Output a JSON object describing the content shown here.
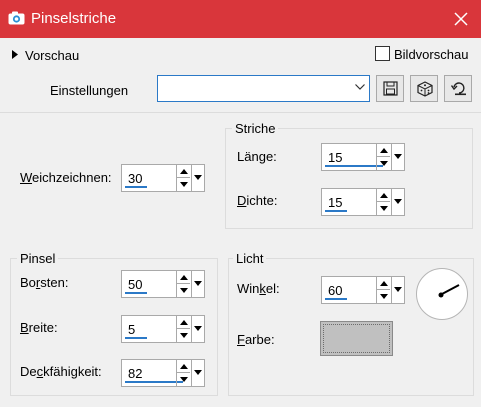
{
  "window": {
    "title": "Pinselstriche",
    "accent_color": "#d9363b",
    "icon": "camera-icon"
  },
  "preview": {
    "label": "Vorschau",
    "bild_label": "Bildvorschau",
    "bild_checked": false
  },
  "settings": {
    "label": "Einstellungen",
    "value": ""
  },
  "toolbar": {
    "icons": [
      "save-icon",
      "random-dice-icon",
      "reset-icon"
    ]
  },
  "weich": {
    "label_u": "W",
    "label_rest": "eichzeichnen:",
    "value": "30"
  },
  "striche": {
    "title": "Striche",
    "laenge": {
      "label_pre": "Län",
      "label_u": "g",
      "label_post": "e:",
      "value": "15"
    },
    "dichte": {
      "label_u": "D",
      "label_rest": "ichte:",
      "value": "15"
    }
  },
  "pinsel": {
    "title": "Pinsel",
    "borsten": {
      "label_pre": "Bo",
      "label_u": "r",
      "label_post": "sten:",
      "value": "50"
    },
    "breite": {
      "label_u": "B",
      "label_rest": "reite:",
      "value": "5"
    },
    "deck": {
      "label_pre": "De",
      "label_u": "c",
      "label_post": "kfähigkeit:",
      "value": "82"
    }
  },
  "licht": {
    "title": "Licht",
    "winkel": {
      "label_pre": "Win",
      "label_u": "k",
      "label_post": "el:",
      "value": "60"
    },
    "farbe": {
      "label_u": "F",
      "label_rest": "arbe:",
      "color": "#c0c0c0"
    }
  }
}
